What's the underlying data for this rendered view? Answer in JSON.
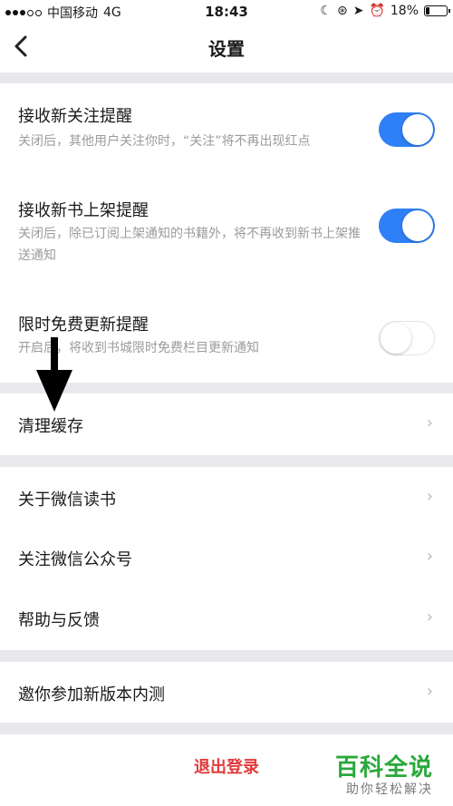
{
  "status_bar": {
    "carrier": "中国移动",
    "network": "4G",
    "time": "18:43",
    "battery": "18%",
    "battery_level": 0.18
  },
  "nav": {
    "title": "设置",
    "back_icon": "chevron-left-icon"
  },
  "notifications": [
    {
      "title": "接收新关注提醒",
      "desc": "关闭后，其他用户关注你时，“关注”将不再出现红点",
      "on": true
    },
    {
      "title": "接收新书上架提醒",
      "desc": "关闭后，除已订阅上架通知的书籍外，将不再收到新书上架推送通知",
      "on": true
    },
    {
      "title": "限时免费更新提醒",
      "desc": "开启后，将收到书城限时免费栏目更新通知",
      "on": false
    }
  ],
  "cache": {
    "label": "清理缓存"
  },
  "about_items": [
    {
      "label": "关于微信读书"
    },
    {
      "label": "关注微信公众号"
    },
    {
      "label": "帮助与反馈"
    }
  ],
  "beta": {
    "label": "邀你参加新版本内测"
  },
  "logout": {
    "label": "退出登录"
  },
  "watermark": {
    "main": "百科全说",
    "sub": "助你轻松解决"
  },
  "colors": {
    "accent": "#2f7ff7",
    "danger": "#e23b3b",
    "watermark": "#2aa83b"
  }
}
